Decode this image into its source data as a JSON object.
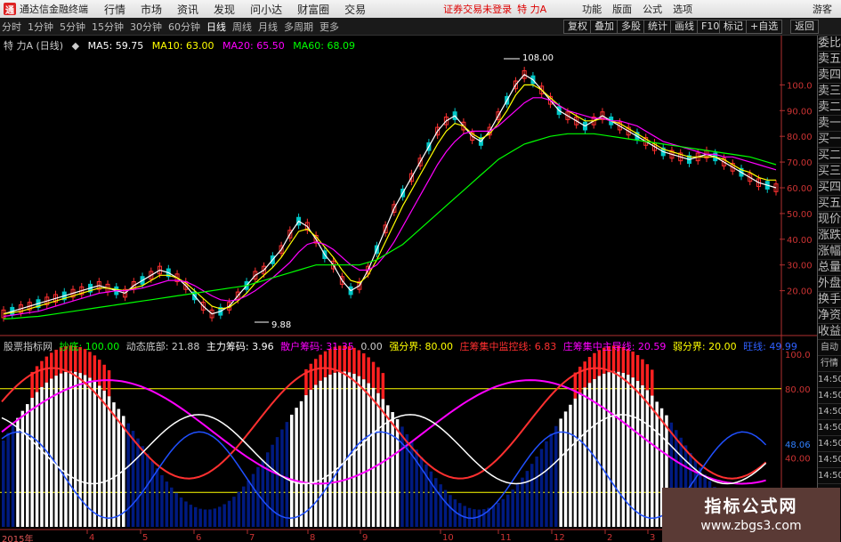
{
  "topbar": {
    "app_name": "通达信金融终端",
    "menus": [
      "行情",
      "市场",
      "资讯",
      "发现",
      "问小达",
      "财富圈",
      "交易"
    ],
    "status": "证券交易未登录",
    "stock": "特 力A",
    "right_items": [
      "功能",
      "版面",
      "公式",
      "选项"
    ],
    "user": "游客"
  },
  "toolbar": {
    "periods": [
      "分时",
      "1分钟",
      "5分钟",
      "15分钟",
      "30分钟",
      "60分钟",
      "日线",
      "周线",
      "月线",
      "多周期",
      "更多"
    ],
    "active_period": "日线",
    "right_buttons": [
      "复权",
      "叠加",
      "多股",
      "统计",
      "画线",
      "F10",
      "标记",
      "+自选",
      "返回"
    ]
  },
  "main_legend": {
    "title": "特 力A (日线)",
    "ma": [
      {
        "label": "MA5: 59.75",
        "color": "#ffffff"
      },
      {
        "label": "MA10: 63.00",
        "color": "#ffff00"
      },
      {
        "label": "MA20: 65.50",
        "color": "#ff00ff"
      },
      {
        "label": "MA60: 68.09",
        "color": "#00ff00"
      }
    ]
  },
  "price_axis": [
    "100.0",
    "90.00",
    "80.00",
    "70.00",
    "60.00",
    "50.00",
    "40.00",
    "30.00",
    "20.00"
  ],
  "annotations": {
    "high": "108.00",
    "low": "9.88"
  },
  "sidebar": [
    "委比",
    "卖五",
    "卖四",
    "卖三",
    "卖二",
    "卖一",
    "买一",
    "买二",
    "买三",
    "买四",
    "买五",
    "现价",
    "涨跌",
    "涨幅",
    "总量",
    "外盘",
    "换手",
    "净资",
    "收益"
  ],
  "sub_legend": {
    "items": [
      {
        "label": "股票指标网",
        "color": "#cccccc"
      },
      {
        "label": "抄底: 100.00",
        "color": "#00ff00"
      },
      {
        "label": "动态底部: 21.88",
        "color": "#cccccc"
      },
      {
        "label": "主力筹码: 3.96",
        "color": "#ffffff"
      },
      {
        "label": "散户筹码: 31.35",
        "color": "#ff00ff"
      },
      {
        "label": "0.00",
        "color": "#cccccc"
      },
      {
        "label": "强分界: 80.00",
        "color": "#ffff00"
      },
      {
        "label": "庄筹集中监控线: 6.83",
        "color": "#ff3030"
      },
      {
        "label": "庄筹集中主导线: 20.59",
        "color": "#ff00ff"
      },
      {
        "label": "弱分界: 20.00",
        "color": "#ffff00"
      },
      {
        "label": "旺线: 49.99",
        "color": "#3060ff"
      }
    ]
  },
  "sub_axis": [
    "100.0",
    "80.00",
    "48.06",
    "40.00"
  ],
  "sub_side": [
    "自动",
    "行情",
    "14:50",
    "14:50",
    "14:50",
    "14:50",
    "14:50",
    "14:50",
    "14:50"
  ],
  "date_axis": {
    "year": "2015年",
    "months": [
      "4",
      "5",
      "6",
      "7",
      "8",
      "9",
      "10",
      "11",
      "12",
      "2",
      "3"
    ]
  },
  "watermark": {
    "title": "指标公式网",
    "url": "www.zbgs3.com"
  },
  "colors": {
    "up": "#ff3030",
    "down": "#00c8c8",
    "white": "#ffffff",
    "magenta": "#ff00ff",
    "green": "#00ff00",
    "blue": "#2050ff",
    "yellow": "#ffff00",
    "navy": "#001a80"
  },
  "chart_data": {
    "type": "line",
    "title": "特 力A (日线)",
    "series": [
      {
        "name": "MA5",
        "values": [
          11,
          12,
          13,
          14,
          15,
          16,
          17,
          18,
          19,
          20,
          21,
          22,
          21,
          20,
          19,
          22,
          24,
          26,
          28,
          27,
          25,
          22,
          18,
          14,
          11,
          12,
          14,
          18,
          22,
          26,
          28,
          32,
          36,
          42,
          47,
          45,
          40,
          34,
          30,
          24,
          20,
          22,
          28,
          36,
          44,
          52,
          58,
          64,
          70,
          76,
          82,
          86,
          88,
          84,
          80,
          78,
          82,
          88,
          94,
          100,
          104,
          102,
          98,
          94,
          90,
          88,
          86,
          84,
          86,
          88,
          86,
          84,
          82,
          80,
          78,
          76,
          74,
          73,
          72,
          71,
          72,
          73,
          72,
          70,
          68,
          66,
          64,
          62,
          61,
          60
        ]
      },
      {
        "name": "MA10",
        "values": [
          11,
          11.5,
          12,
          13,
          14,
          15,
          16,
          17,
          18,
          19,
          20,
          21,
          21,
          20.5,
          20,
          21,
          22,
          24,
          26,
          26,
          25,
          23,
          20,
          17,
          14,
          13,
          13.5,
          16,
          19,
          23,
          26,
          29,
          33,
          38,
          43,
          44,
          41,
          37,
          33,
          28,
          24,
          23,
          26,
          32,
          39,
          46,
          53,
          59,
          65,
          71,
          77,
          82,
          85,
          84,
          81,
          79,
          81,
          85,
          90,
          96,
          100,
          100,
          98,
          95,
          92,
          90,
          88,
          86,
          86,
          87,
          86,
          85,
          83,
          81,
          79,
          77,
          75,
          74,
          73,
          72,
          72,
          72,
          72,
          71,
          69,
          67,
          66,
          64,
          63,
          63
        ]
      },
      {
        "name": "MA20",
        "values": [
          10,
          10.5,
          11,
          11.5,
          12,
          13,
          14,
          15,
          16,
          17,
          18,
          19,
          19.5,
          20,
          20,
          20.5,
          21,
          22,
          23,
          24,
          24,
          23.5,
          22,
          20,
          18,
          16.5,
          16,
          16.5,
          18,
          20,
          22.5,
          25,
          28,
          31,
          35,
          38,
          39,
          38,
          36,
          33,
          30,
          28,
          28,
          30,
          34,
          39,
          45,
          51,
          57,
          63,
          69,
          74,
          78,
          81,
          82,
          82,
          82,
          84,
          87,
          90,
          93,
          95,
          95,
          94,
          92,
          90,
          89,
          88,
          87,
          87,
          86,
          86,
          85,
          84,
          82,
          80,
          78,
          77,
          76,
          75,
          74,
          73,
          73,
          72,
          72,
          71,
          70,
          69,
          68,
          67
        ]
      },
      {
        "name": "MA60",
        "values": [
          9,
          9.2,
          9.5,
          9.8,
          10,
          10.5,
          11,
          11.5,
          12,
          12.5,
          13,
          13.5,
          14,
          14.5,
          15,
          15.5,
          16,
          16.5,
          17,
          17.5,
          18,
          18.5,
          19,
          19.5,
          20,
          20.5,
          21,
          21.5,
          22,
          23,
          24,
          25,
          26,
          27,
          28,
          29,
          30,
          30,
          30,
          30,
          30,
          30,
          31,
          32,
          34,
          36,
          38,
          41,
          44,
          47,
          50,
          53,
          56,
          59,
          62,
          65,
          68,
          71,
          73,
          75,
          77,
          78,
          79,
          80,
          80.5,
          81,
          81,
          81,
          81,
          80.5,
          80,
          79.5,
          79,
          78.5,
          78,
          77.5,
          77,
          76.5,
          76,
          75.5,
          75,
          74.5,
          74,
          73.5,
          73,
          72.5,
          72,
          71,
          70,
          69
        ]
      }
    ],
    "high_point": 108.0,
    "low_point": 9.88,
    "ylim": [
      5,
      115
    ]
  }
}
